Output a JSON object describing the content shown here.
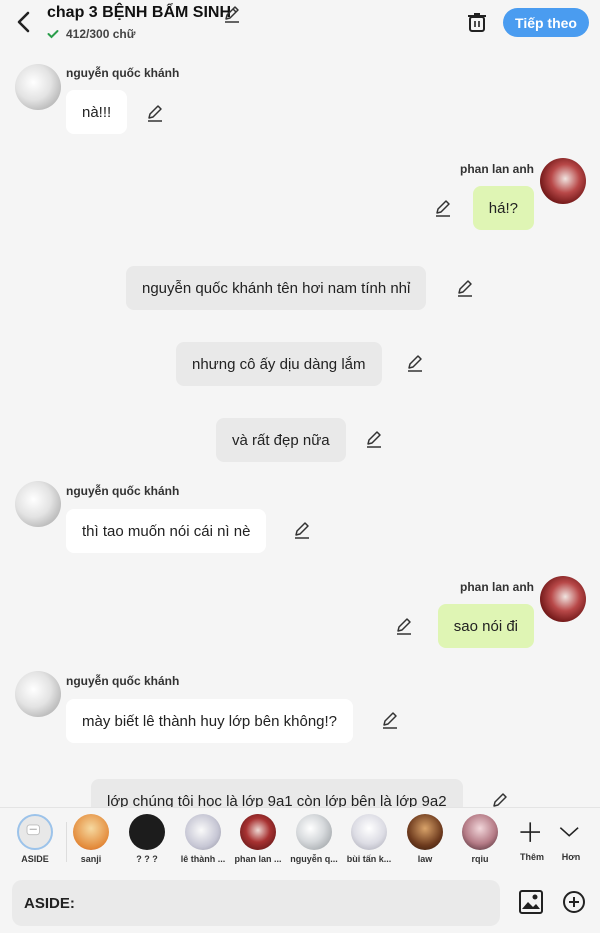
{
  "header": {
    "title": "chap 3 BỆNH BẨM SINH",
    "word_count": "412/300 chữ",
    "next_label": "Tiếp theo"
  },
  "messages": [
    {
      "speaker": "nguyễn quốc khánh",
      "text": "nà!!!",
      "side": "left"
    },
    {
      "speaker": "phan lan anh",
      "text": "há!?",
      "side": "right"
    },
    {
      "text": "nguyễn quốc khánh tên hơi nam tính nhỉ",
      "side": "center"
    },
    {
      "text": "nhưng cô ấy dịu dàng lắm",
      "side": "center"
    },
    {
      "text": "và rất đẹp nữa",
      "side": "center"
    },
    {
      "speaker": "nguyễn quốc khánh",
      "text": "thì tao muốn nói cái nì nè",
      "side": "left"
    },
    {
      "speaker": "phan lan anh",
      "text": "sao nói đi",
      "side": "right"
    },
    {
      "speaker": "nguyễn quốc khánh",
      "text": "mày biết lê thành huy lớp bên không!?",
      "side": "left"
    },
    {
      "text": "lớp chúng tôi học là lớp 9a1 còn lớp bên là lớp 9a2",
      "side": "center"
    }
  ],
  "characters": [
    {
      "label": "ASIDE",
      "color": "#e8e8e8"
    },
    {
      "label": "sanji",
      "color": "#f3c27a"
    },
    {
      "label": "? ? ?",
      "color": "#1c1c1c"
    },
    {
      "label": "lê thành ...",
      "color": "#d9d9e6"
    },
    {
      "label": "phan lan ...",
      "color": "#8e2424"
    },
    {
      "label": "nguyễn q...",
      "color": "#cfd3d6"
    },
    {
      "label": "bùi tấn k...",
      "color": "#e2e2e8"
    },
    {
      "label": "law",
      "color": "#6e3b1e"
    },
    {
      "label": "rqiu",
      "color": "#b57b86"
    }
  ],
  "actions": {
    "add_label": "Thêm",
    "more_label": "Hơn"
  },
  "input": {
    "value": "ASIDE:"
  },
  "colors": {
    "accent": "#4a9cf0",
    "bubble_green": "#dff5b4",
    "bubble_gray": "#e9e9e9"
  }
}
